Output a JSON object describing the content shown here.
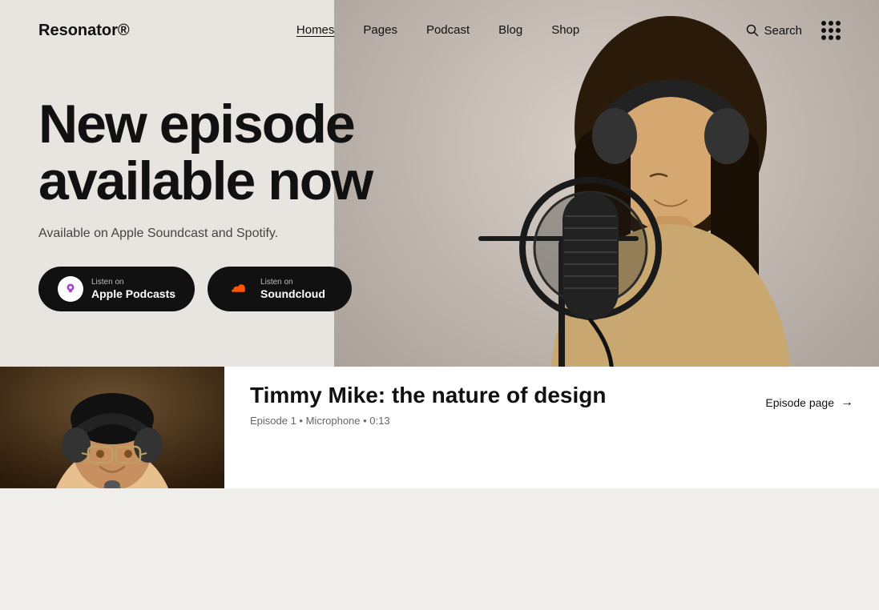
{
  "brand": {
    "logo": "Resonator®"
  },
  "nav": {
    "links": [
      {
        "label": "Homes",
        "active": true
      },
      {
        "label": "Pages",
        "active": false
      },
      {
        "label": "Podcast",
        "active": false
      },
      {
        "label": "Blog",
        "active": false
      },
      {
        "label": "Shop",
        "active": false
      }
    ],
    "search_label": "Search"
  },
  "hero": {
    "title": "New episode available now",
    "subtitle": "Available on Apple Soundcast and Spotify.",
    "btn_apple_listen_on": "Listen on",
    "btn_apple_platform": "Apple Podcasts",
    "btn_soundcloud_listen_on": "Listen on",
    "btn_soundcloud_platform": "Soundcloud"
  },
  "episode_card": {
    "title": "Timmy Mike: the nature of design",
    "meta": "Episode 1 • Microphone • 0:13",
    "episode_link": "Episode page"
  }
}
